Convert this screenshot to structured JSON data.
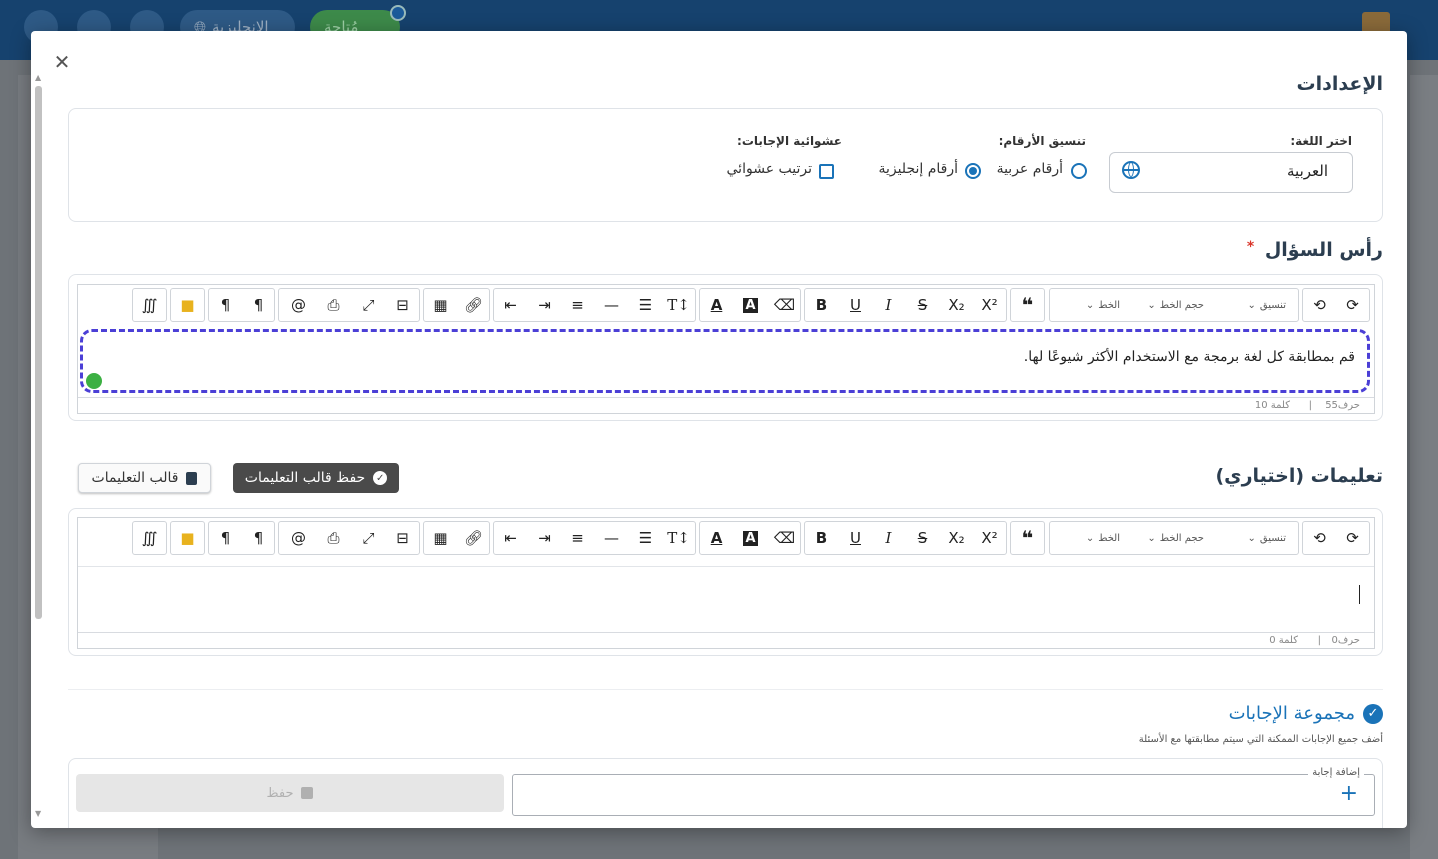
{
  "topbar": {
    "pill_language": "الإنجليزية",
    "pill_status": "مُتاحة"
  },
  "settings": {
    "title": "الإعدادات",
    "language_label": "اختر اللغة:",
    "language_value": "العربية",
    "numbers_label": "تنسيق الأرقام:",
    "numbers_options": [
      "أرقام عربية",
      "أرقام إنجليزية"
    ],
    "numbers_selected": "أرقام إنجليزية",
    "random_label": "عشوائية الإجابات:",
    "random_option": "ترتيب عشوائي"
  },
  "question_head": {
    "title": "رأس السؤال",
    "required_mark": "*",
    "content": "قم بمطابقة كل لغة برمجة مع الاستخدام الأكثر شيوعًا لها.",
    "chars": "حرف55",
    "words": "كلمة 10"
  },
  "toolbar": {
    "format_select": "تنسيق",
    "size_select": "حجم الخط",
    "font_select": "الخط",
    "separator": "|"
  },
  "instructions": {
    "title": "تعليمات (اختياري)",
    "save_template_label": "حفظ قالب التعليمات",
    "template_label": "قالب التعليمات",
    "chars": "حرف0",
    "words": "كلمة 0"
  },
  "answers": {
    "title": "مجموعة الإجابات",
    "subtitle": "أضف جميع الإجابات الممكنة التي سيتم مطابقتها مع الأسئلة",
    "add_label": "إضافة إجابة",
    "save_label": "حفظ"
  },
  "colors": {
    "accent": "#1a73b8",
    "topbar": "#16426e",
    "focus_border": "#4b3fd6",
    "dark_button": "#4a4a4a"
  }
}
